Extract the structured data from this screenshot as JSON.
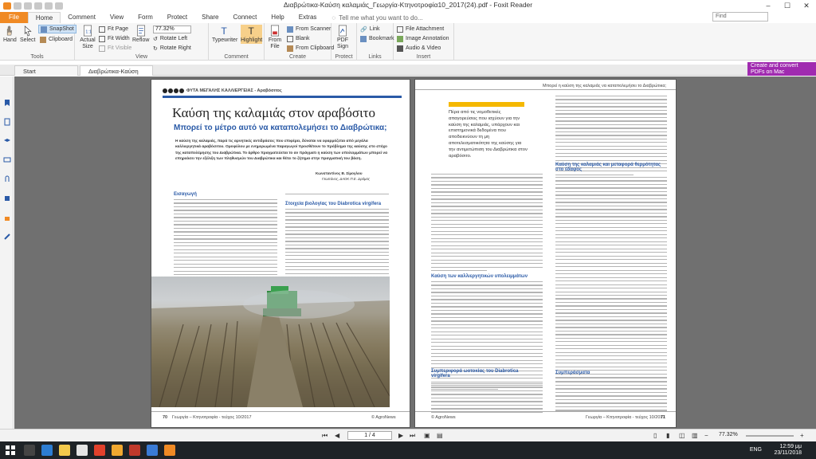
{
  "window": {
    "title": "Διαβρώτικα-Καύση καλαμιάς_Γεωργία-Κτηνοτροφία10_2017(24).pdf - Foxit Reader"
  },
  "menu": {
    "tabs": [
      "File",
      "Home",
      "Comment",
      "View",
      "Form",
      "Protect",
      "Share",
      "Connect",
      "Help",
      "Extras"
    ],
    "tell_me": "Tell me what you want to do...",
    "find_placeholder": "Find"
  },
  "ribbon": {
    "hand": "Hand",
    "select": "Select",
    "snapshot": "SnapShot",
    "clipboard": "Clipboard",
    "actual_size": "Actual Size",
    "fit_page": "Fit Page",
    "fit_width": "Fit Width",
    "fit_visible": "Fit Visible",
    "reflow": "Reflow",
    "zoom": "77.32%",
    "rotate_left": "Rotate Left",
    "rotate_right": "Rotate Right",
    "typewriter": "Typewriter",
    "highlight": "Highlight",
    "from_file": "From File",
    "from_scanner": "From Scanner",
    "blank": "Blank",
    "from_clipboard": "From Clipboard",
    "pdf_sign": "PDF Sign",
    "link": "Link",
    "bookmark": "Bookmark",
    "file_attachment": "File Attachment",
    "image_annotation": "Image Annotation",
    "audio_video": "Audio & Video",
    "groups": {
      "tools": "Tools",
      "view": "View",
      "comment": "Comment",
      "create": "Create",
      "protect": "Protect",
      "links": "Links",
      "insert": "Insert"
    }
  },
  "promo": {
    "text": "Create and convert PDFs on Mac"
  },
  "doc_tabs": {
    "start": "Start",
    "current": "Διαβρώτικα-Καύση καλα..."
  },
  "page_left": {
    "header": "ΦΥΤΑ ΜΕΓΑΛΗΣ ΚΑΛΛΙΕΡΓΕΙΑΣ - Αραβόσιτος",
    "title": "Καύση της καλαμιάς στον αραβόσιτο",
    "subtitle": "Μπορεί το μέτρο αυτό να καταπολεμήσει το Διαβρώτικα;",
    "intro": "Η καύση της καλαμιάς, παρά τις αρνητικές αντιδράσεις που επιφέρει, δύναται να εφαρμόζεται από μεγάλα καλλιεργητικά αραβόσιτου. Ομοφύλου με ενημερωμένα παραγωγοί προσθέτουν το πρόβλημα της καύσης στο στόχο της καταπολέμησης του Διαβρώτικα. Το άρθρο πραγματεύεται το αν πράγματι η καύση των υπολειμμάτων μπορεί να επηρεάσει την εξέλιξη των πληθυσμών του Διαβρώτικα και θέτει το ζήτημα στην πραγματική του βάση.",
    "author": "Κωνσταντίνος Β. Σίμογλου",
    "affiliation": "Γεωπόνος, ΔΑΟΚ Π.Ε. Δράμας",
    "section1": "Εισαγωγή",
    "section2": "Στοιχεία βιολογίας του Diabrotica virgifera",
    "footer_left": "Γεωργία – Κτηνοτροφία - τεύχος 10/2017",
    "footer_right": "© AgroNews",
    "page_num": "70"
  },
  "page_right": {
    "header": "Μπορεί η καύση της καλαμιάς να καταπολεμήσει το Διαβρώτικα;",
    "callout": "Πέρα από τις νομοθετικές απαγορεύσεις που ισχύουν για την καύση της καλαμιάς, υπάρχουν και επιστημονικά δεδομένα που αποδεικνύουν τη μη αποτελεσματικότητα της καύσης για την αντιμετώπιση του Διαβρώτικα στον αραβόσιτο.",
    "section1": "Καύση της καλαμιάς και μεταφορά θερμότητας στο έδαφος",
    "section2": "Καύση των καλλιεργητικών υπολειμμάτων",
    "section3": "Συμπεριφορά ωοτοκίας του Diabrotica virgifera",
    "section4": "Συμπεράσματα",
    "footer_left": "© AgroNews",
    "footer_right": "Γεωργία – Κτηνοτροφία - τεύχος 10/2017",
    "page_num": "71"
  },
  "status": {
    "page": "1 / 4",
    "zoom": "77.32%"
  },
  "taskbar": {
    "time": "12:59 μμ",
    "date": "23/11/2018",
    "lang": "ENG"
  },
  "colors": {
    "accent": "#f08a24",
    "heading_blue": "#2a5aa7",
    "promo": "#a02bb0"
  }
}
